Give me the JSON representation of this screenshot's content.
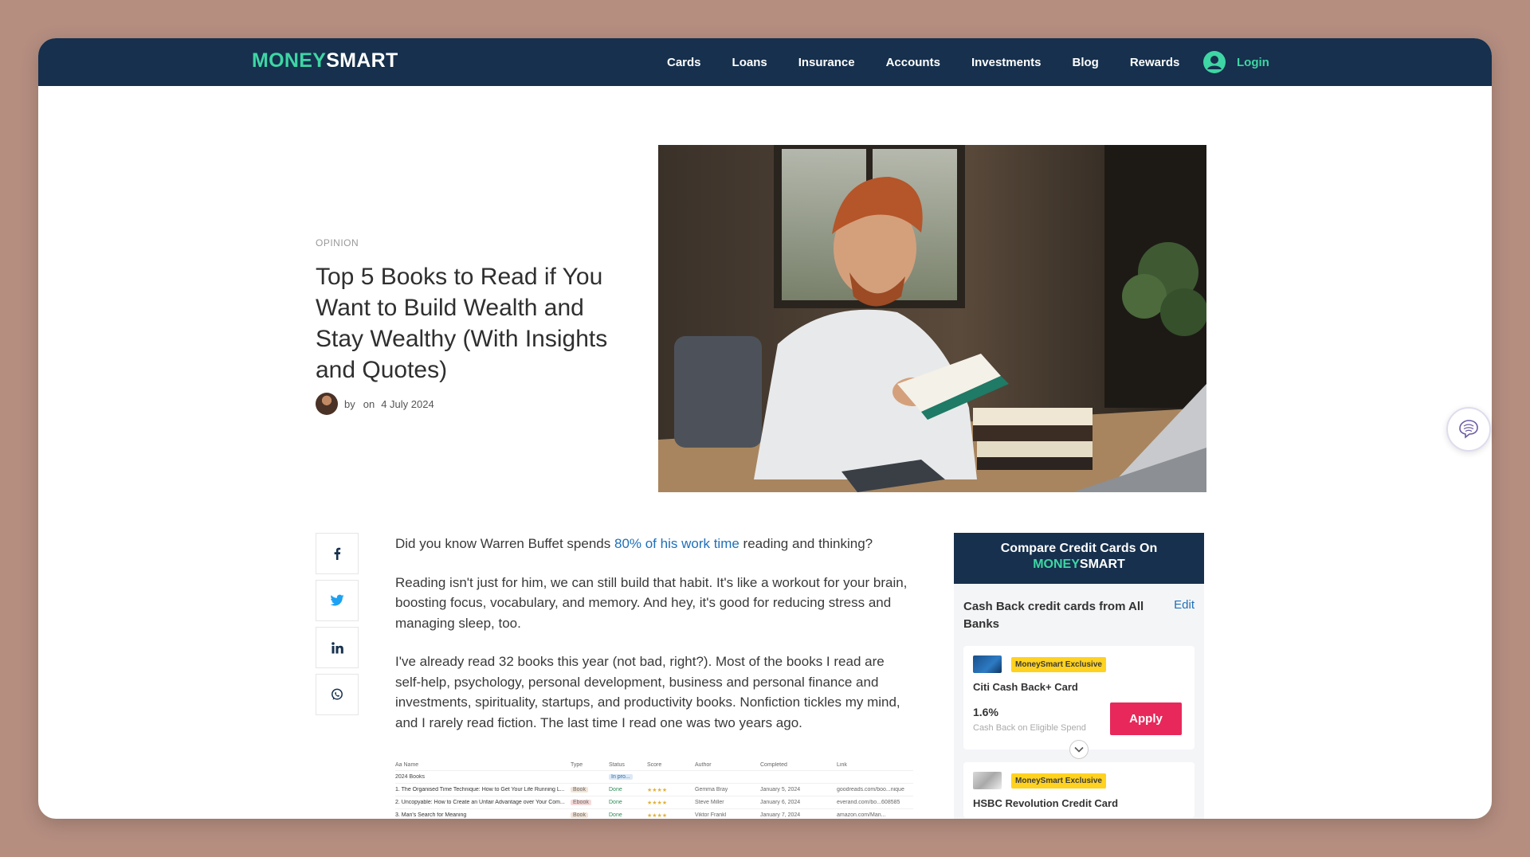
{
  "nav": {
    "logo_money": "MONEY",
    "logo_smart": "SMART",
    "items": [
      {
        "label": "Cards"
      },
      {
        "label": "Loans"
      },
      {
        "label": "Insurance"
      },
      {
        "label": "Accounts"
      },
      {
        "label": "Investments"
      },
      {
        "label": "Blog"
      },
      {
        "label": "Rewards"
      }
    ],
    "login_label": "Login"
  },
  "hero": {
    "category": "OPINION",
    "title": "Top 5 Books to Read if You Want to Build Wealth and Stay Wealthy (With Insights and Quotes)",
    "by_label": "by",
    "on_label": "on",
    "date": "4 July 2024"
  },
  "share": {
    "icons": [
      "facebook-icon",
      "twitter-icon",
      "linkedin-icon",
      "whatsapp-icon"
    ]
  },
  "article": {
    "p1_before": "Did you know Warren Buffet spends ",
    "p1_link": "80% of his work time",
    "p1_after": " reading and thinking?",
    "p2": "Reading isn't just for him, we can still build that habit. It's like a workout for your brain, boosting focus, vocabulary, and memory. And hey, it's good for reducing stress and managing sleep, too.",
    "p3": "I've already read 32 books this year (not bad, right?). Most of the books I read are self-help, psychology, personal development, business and personal finance and investments, spirituality, startups, and productivity books. Nonfiction tickles my mind, and I rarely read fiction. The last time I read one was two years ago."
  },
  "reading_table": {
    "headers": [
      "Aa Name",
      "Type",
      "Status",
      "Score",
      "Author",
      "Completed",
      "Link"
    ],
    "group_label": "2024 Books",
    "group_status": "In pro...",
    "rows": [
      {
        "name": "1. The Organised Time Technique: How to Get Your Life Running L...",
        "type": "Book",
        "status": "Done",
        "score": "★★★★",
        "author": "Gemma Bray",
        "completed": "January 5, 2024",
        "link": "goodreads.com/boo...nique"
      },
      {
        "name": "2. Uncopyable: How to Create an Unfair Advantage over Your Com...",
        "type": "Ebook",
        "status": "Done",
        "score": "★★★★",
        "author": "Steve Miller",
        "completed": "January 6, 2024",
        "link": "everand.com/bo...608585"
      },
      {
        "name": "3. Man's Search for Meaning",
        "type": "Book",
        "status": "Done",
        "score": "★★★★",
        "author": "Viktor Frankl",
        "completed": "January 7, 2024",
        "link": "amazon.com/Man..."
      }
    ]
  },
  "widget": {
    "head_line1": "Compare Credit Cards On",
    "head_money": "MONEY",
    "head_smart": "SMART",
    "filter_label": "Cash Back credit cards from All Banks",
    "edit_label": "Edit",
    "cards": [
      {
        "badge": "MoneySmart Exclusive",
        "name": "Citi Cash Back+ Card",
        "rate": "1.6%",
        "rate_label": "Cash Back on Eligible Spend",
        "apply_label": "Apply"
      },
      {
        "badge": "MoneySmart Exclusive",
        "name": "HSBC Revolution Credit Card"
      }
    ]
  },
  "colors": {
    "navy": "#16304d",
    "mint": "#3ed6a4",
    "apply_pink": "#e8285a",
    "badge_yellow": "#ffd21f",
    "link_blue": "#1f6fb8"
  }
}
